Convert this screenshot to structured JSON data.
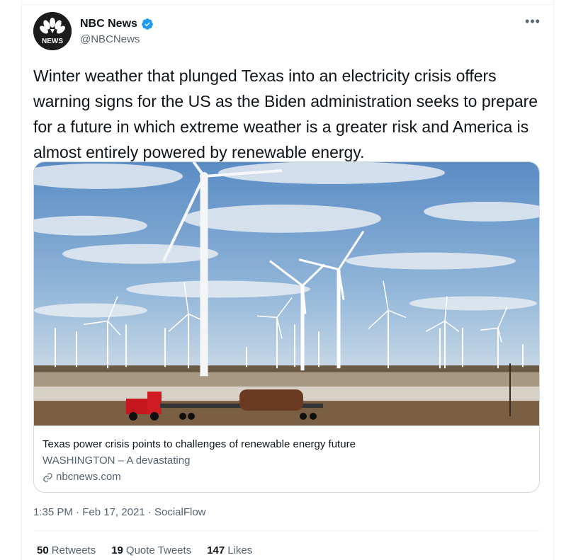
{
  "author": {
    "name": "NBC News",
    "handle": "@NBCNews",
    "avatar_text": "NEWS"
  },
  "more_label": "•••",
  "tweet": {
    "text": "Winter weather that plunged Texas into an electricity crisis offers warning signs for the US as the Biden administration seeks to prepare for a future in which extreme weather is a greater risk and America is almost entirely powered by renewable energy."
  },
  "card": {
    "image_alt": "wind turbines",
    "title": "Texas power crisis points to challenges of renewable energy future",
    "description": "WASHINGTON – A devastating",
    "domain": "nbcnews.com"
  },
  "meta": {
    "time": "1:35 PM",
    "separator": "·",
    "date": "Feb 17, 2021",
    "source": "SocialFlow"
  },
  "stats": {
    "retweets_count": "50",
    "retweets_label": "Retweets",
    "quotes_count": "19",
    "quotes_label": "Quote Tweets",
    "likes_count": "147",
    "likes_label": "Likes"
  },
  "colors": {
    "accent": "#1d9bf0",
    "text_primary": "#0f1419",
    "text_secondary": "#536471",
    "border": "#cfd9de"
  }
}
